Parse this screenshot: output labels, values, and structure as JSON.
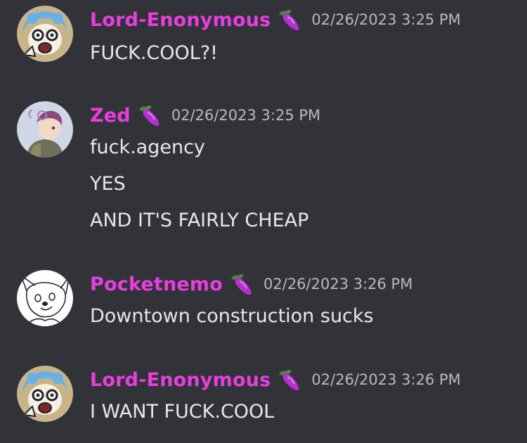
{
  "colors": {
    "background": "#313338",
    "username": "#e83de0",
    "timestamp": "#b5bac1",
    "message_text": "#e6e8ea"
  },
  "role_icon": "eggplant-icon",
  "messages": [
    {
      "username": "Lord-Enonymous",
      "timestamp": "02/26/2023 3:25 PM",
      "avatar": "anime-avatar",
      "lines": [
        "FUCK.COOL?!"
      ]
    },
    {
      "username": "Zed",
      "timestamp": "02/26/2023 3:25 PM",
      "avatar": "character-avatar",
      "lines": [
        "fuck.agency",
        "YES",
        "AND IT'S FAIRLY CHEAP"
      ]
    },
    {
      "username": "Pocketnemo",
      "timestamp": "02/26/2023 3:26 PM",
      "avatar": "sketch-avatar",
      "lines": [
        "Downtown construction sucks"
      ]
    },
    {
      "username": "Lord-Enonymous",
      "timestamp": "02/26/2023 3:26 PM",
      "avatar": "anime-avatar",
      "lines": [
        "I WANT FUCK.COOL"
      ]
    }
  ]
}
